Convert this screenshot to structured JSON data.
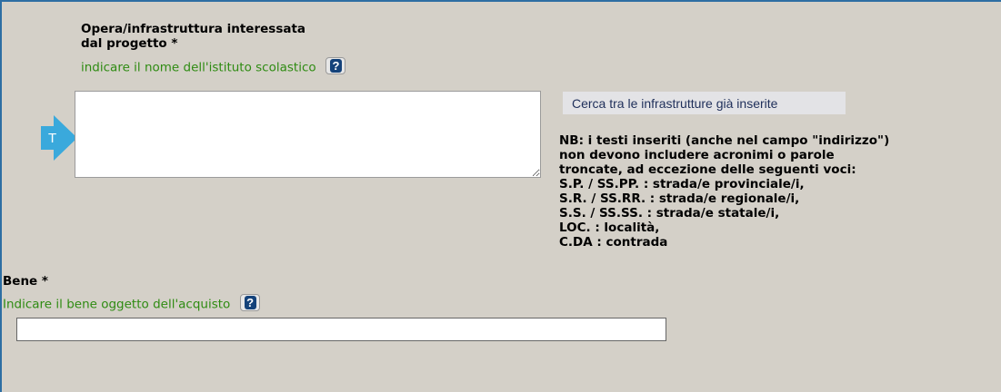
{
  "opera": {
    "label_line1": "Opera/infrastruttura interessata",
    "label_line2": "dal progetto *",
    "hint": "indicare il nome dell'istituto scolastico",
    "help_icon": "question-icon",
    "textarea_value": "",
    "arrow_letter": "T"
  },
  "search_button_label": "Cerca tra le infrastrutture già inserite",
  "nb_lines": [
    "NB: i testi inseriti (anche nel campo \"indirizzo\")",
    "non devono includere acronimi o parole",
    "troncate, ad eccezione delle seguenti voci:",
    "S.P. / SS.PP. : strada/e provinciale/i,",
    "S.R. / SS.RR. : strada/e regionale/i,",
    "S.S. / SS.SS. : strada/e statale/i,",
    "LOC. : località,",
    "C.DA : contrada"
  ],
  "bene": {
    "label": "Bene *",
    "hint": "Indicare il bene oggetto dell'acquisto",
    "help_icon": "question-icon",
    "input_value": ""
  },
  "colors": {
    "background": "#d4d0c8",
    "frame": "#2d6ea3",
    "hint_green": "#2e8b12",
    "arrow": "#3aa9dc",
    "help_icon_bg": "#14427a"
  }
}
